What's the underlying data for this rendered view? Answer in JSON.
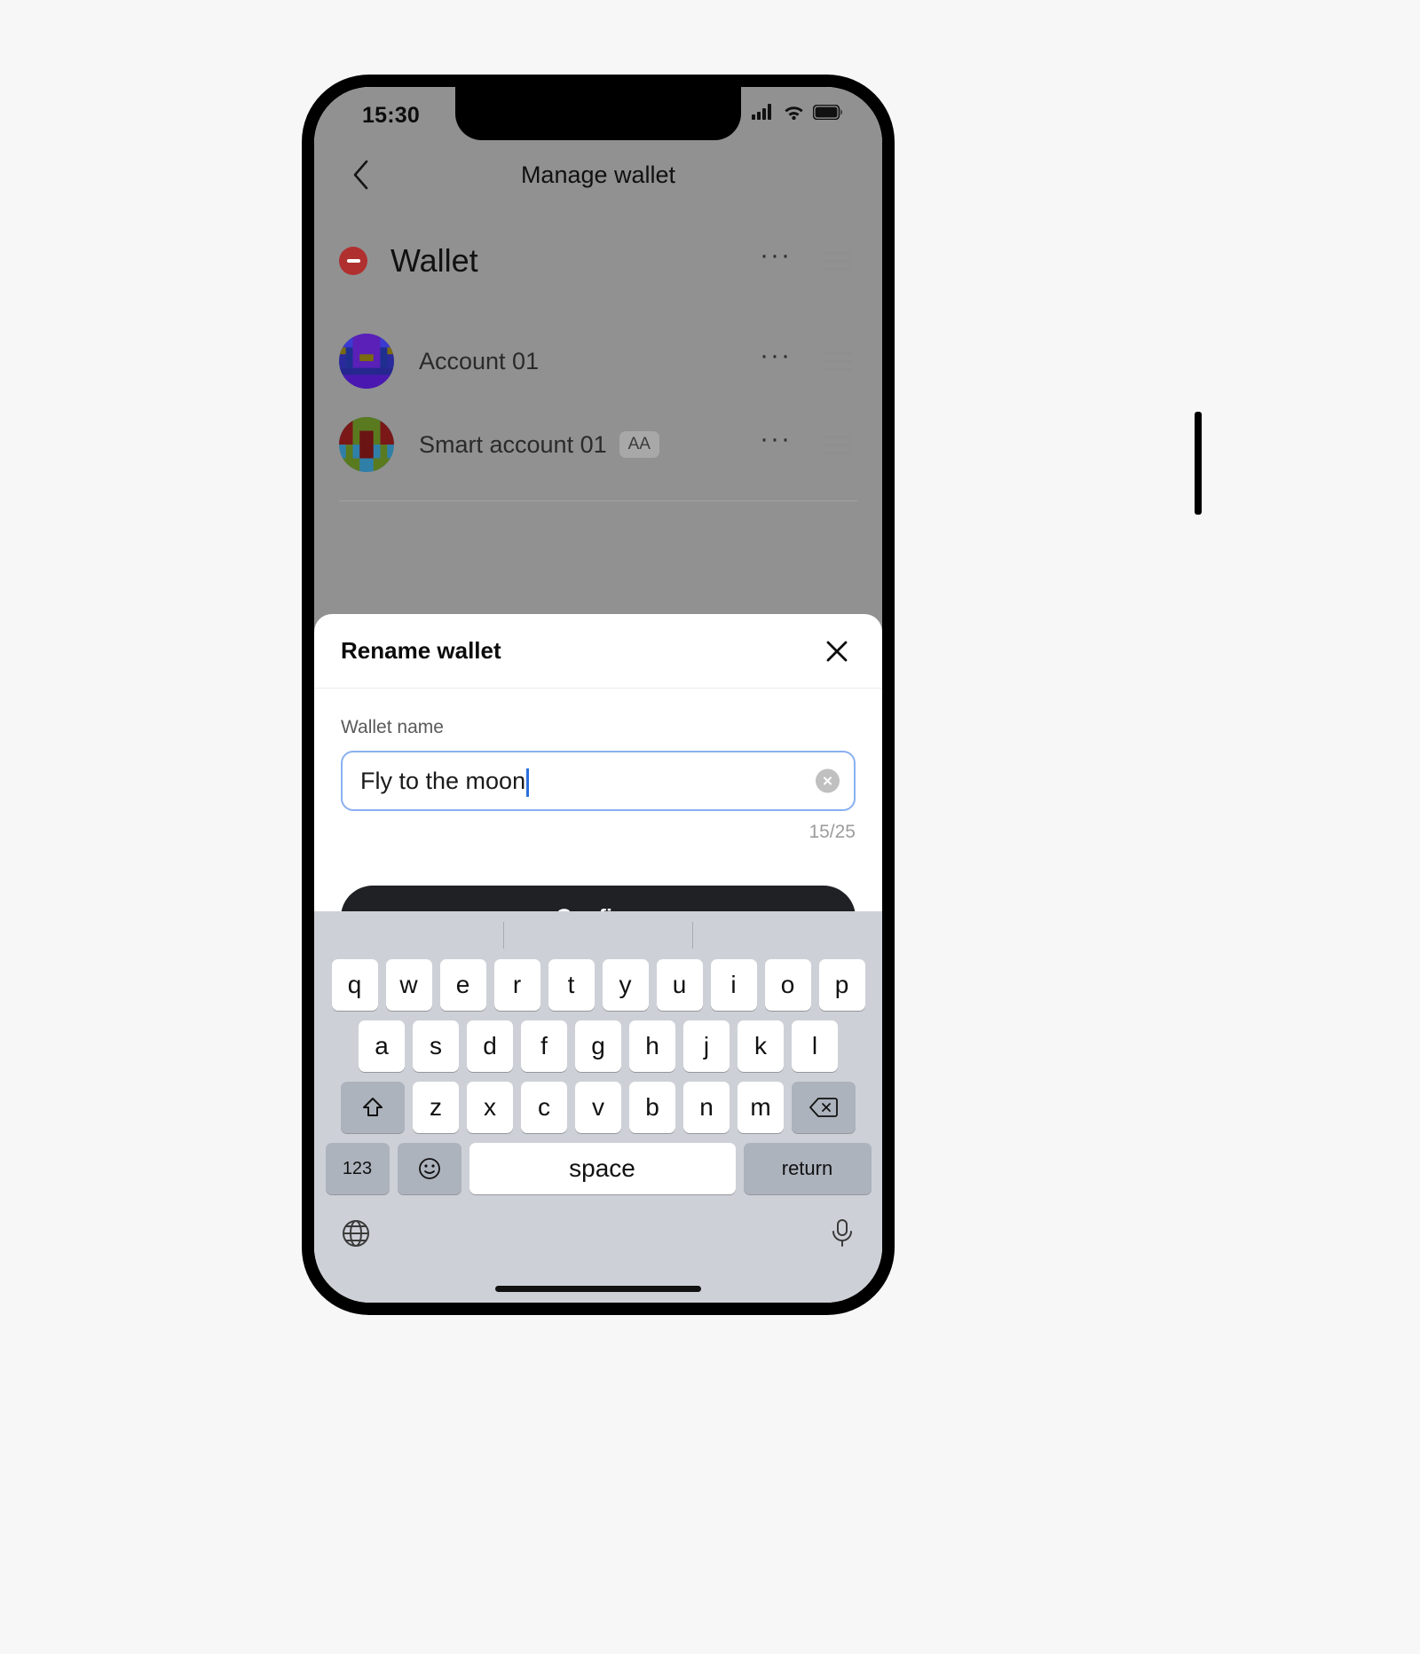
{
  "status_bar": {
    "time": "15:30",
    "icons": [
      "cellular-signal-icon",
      "wifi-icon",
      "battery-icon"
    ]
  },
  "nav": {
    "back_icon": "chevron-left-icon",
    "title": "Manage wallet"
  },
  "wallet": {
    "remove_icon": "minus-circle-icon",
    "name": "Wallet",
    "more_label": "···",
    "drag_icon": "drag-handle-icon",
    "accounts": [
      {
        "avatar": "identicon-blue",
        "label": "Account 01",
        "badge": "",
        "more_label": "···"
      },
      {
        "avatar": "identicon-green",
        "label": "Smart account 01",
        "badge": "AA",
        "more_label": "···"
      }
    ]
  },
  "sheet": {
    "title": "Rename wallet",
    "close_icon": "close-icon",
    "field_label": "Wallet name",
    "input_value": "Fly to the moon",
    "input_placeholder": "Wallet name",
    "clear_icon": "clear-circle-icon",
    "counter": "15/25",
    "confirm_label": "Confirm"
  },
  "keyboard": {
    "row1": [
      "q",
      "w",
      "e",
      "r",
      "t",
      "y",
      "u",
      "i",
      "o",
      "p"
    ],
    "row2": [
      "a",
      "s",
      "d",
      "f",
      "g",
      "h",
      "j",
      "k",
      "l"
    ],
    "row3": [
      "z",
      "x",
      "c",
      "v",
      "b",
      "n",
      "m"
    ],
    "shift_icon": "shift-icon",
    "backspace_icon": "backspace-icon",
    "numbers_label": "123",
    "emoji_icon": "emoji-icon",
    "space_label": "space",
    "return_label": "return",
    "globe_icon": "globe-icon",
    "mic_icon": "microphone-icon"
  },
  "colors": {
    "accent_blue": "#2a6fdb",
    "focus_border": "#8ab0f0",
    "remove_red": "#b03030",
    "confirm_bg": "#1f2124",
    "dim_overlay": "#919191",
    "keyboard_bg": "#cdd1d7"
  }
}
